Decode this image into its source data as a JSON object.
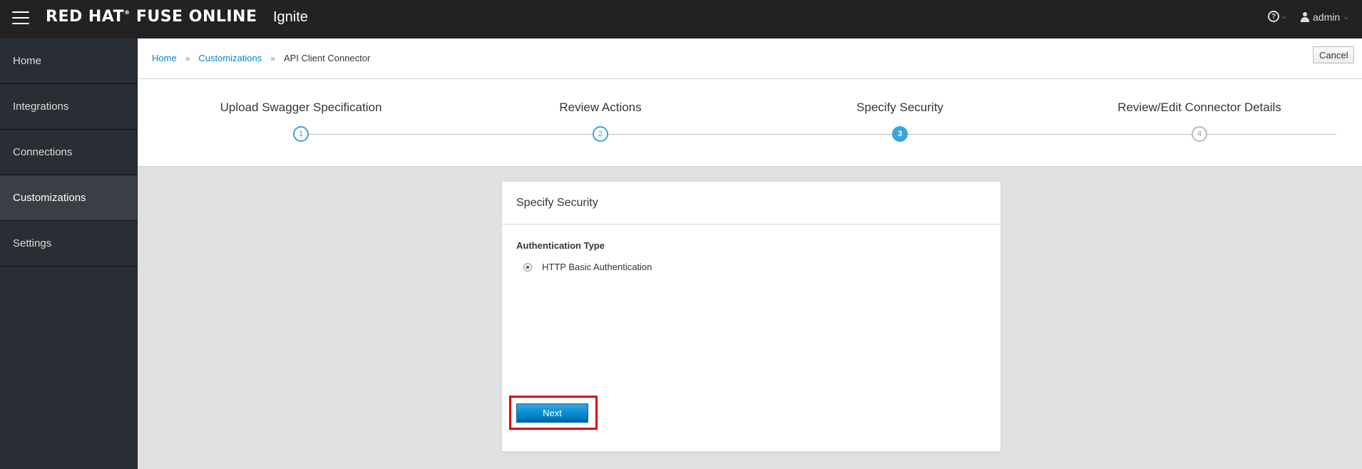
{
  "topbar": {
    "menu_icon": "hamburger-icon",
    "brand_prefix": "RED HAT",
    "brand_reg": "®",
    "brand_suffix": "FUSE ONLINE",
    "project": "Ignite",
    "help_icon": "question-circle-icon",
    "user_icon": "user-icon",
    "user_name": "admin",
    "caret_icon": "chevron-down-icon"
  },
  "sidebar": {
    "items": [
      {
        "label": "Home",
        "active": false
      },
      {
        "label": "Integrations",
        "active": false
      },
      {
        "label": "Connections",
        "active": false
      },
      {
        "label": "Customizations",
        "active": true
      },
      {
        "label": "Settings",
        "active": false
      }
    ]
  },
  "breadcrumb": {
    "items": [
      "Home",
      "Customizations"
    ],
    "separator": "»",
    "current": "API Client Connector"
  },
  "header": {
    "cancel_label": "Cancel"
  },
  "wizard": {
    "steps": [
      {
        "number": "1",
        "title": "Upload Swagger Specification",
        "state": "done"
      },
      {
        "number": "2",
        "title": "Review Actions",
        "state": "done"
      },
      {
        "number": "3",
        "title": "Specify Security",
        "state": "current"
      },
      {
        "number": "4",
        "title": "Review/Edit Connector Details",
        "state": "future"
      }
    ]
  },
  "card": {
    "title": "Specify Security",
    "field_label": "Authentication Type",
    "option_label": "HTTP Basic Authentication",
    "option_selected": true,
    "next_label": "Next"
  },
  "colors": {
    "accent": "#0088ce",
    "step_active": "#39a5dc",
    "highlight": "#e00000"
  }
}
